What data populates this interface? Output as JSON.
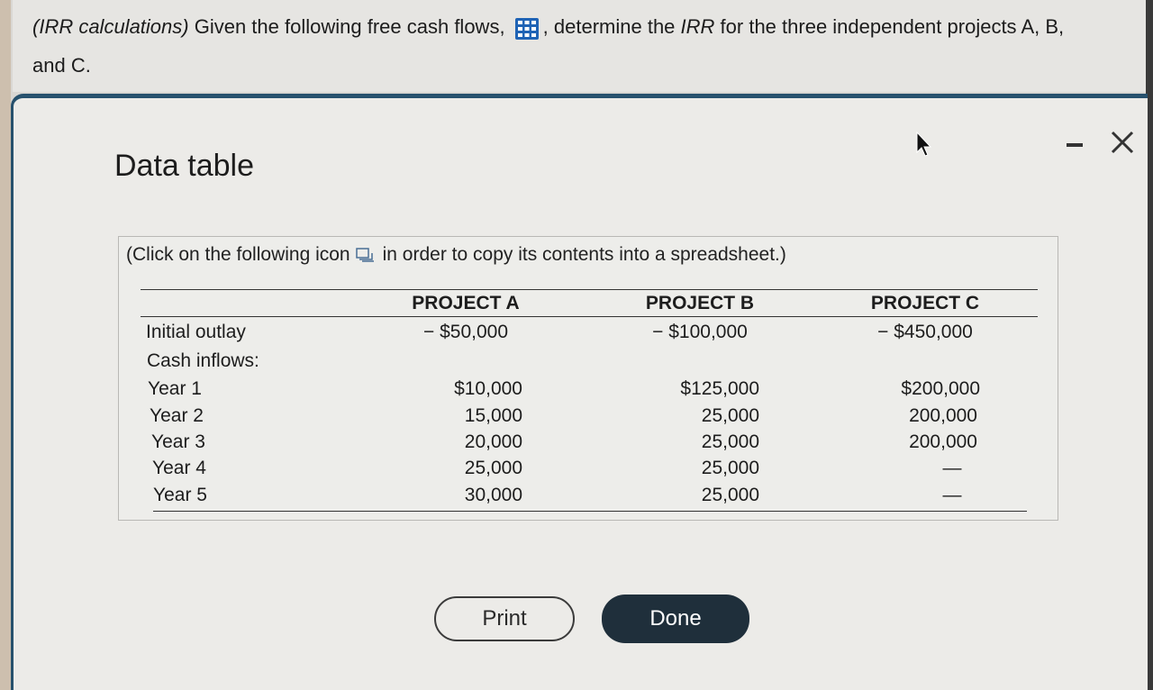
{
  "question": {
    "prefix_italic": "(IRR calculations)",
    "text_before_icon": " Given the following free cash flows, ",
    "text_mid": ", determine the ",
    "irr_italic": "IRR",
    "text_after": " for the three independent projects A, B,",
    "text_line2": "and C.",
    "icon": "table-grid-icon"
  },
  "modal": {
    "title": "Data table",
    "minimize_icon": "minimize-icon",
    "close_icon": "close-icon"
  },
  "instruction": {
    "before": "(Click on the following icon",
    "after": "in order to copy its contents into a spreadsheet.)",
    "icon": "copy-to-spreadsheet-icon"
  },
  "table": {
    "headers": [
      "PROJECT A",
      "PROJECT B",
      "PROJECT C"
    ],
    "rows": [
      {
        "label": "Initial outlay",
        "values": [
          "− $50,000",
          "− $100,000",
          "− $450,000"
        ]
      },
      {
        "label": "Cash inflows:",
        "values": [
          "",
          "",
          ""
        ]
      },
      {
        "label": "Year 1",
        "values": [
          "$10,000",
          "$125,000",
          "$200,000"
        ]
      },
      {
        "label": "Year 2",
        "values": [
          "15,000",
          "25,000",
          "200,000"
        ]
      },
      {
        "label": "Year 3",
        "values": [
          "20,000",
          "25,000",
          "200,000"
        ]
      },
      {
        "label": "Year 4",
        "values": [
          "25,000",
          "25,000",
          "—"
        ]
      },
      {
        "label": "Year 5",
        "values": [
          "30,000",
          "25,000",
          "—"
        ]
      }
    ]
  },
  "buttons": {
    "print": "Print",
    "done": "Done"
  },
  "colors": {
    "accent": "#27516d",
    "done_button": "#1f2f3b",
    "grid_icon": "#1f63b5"
  }
}
